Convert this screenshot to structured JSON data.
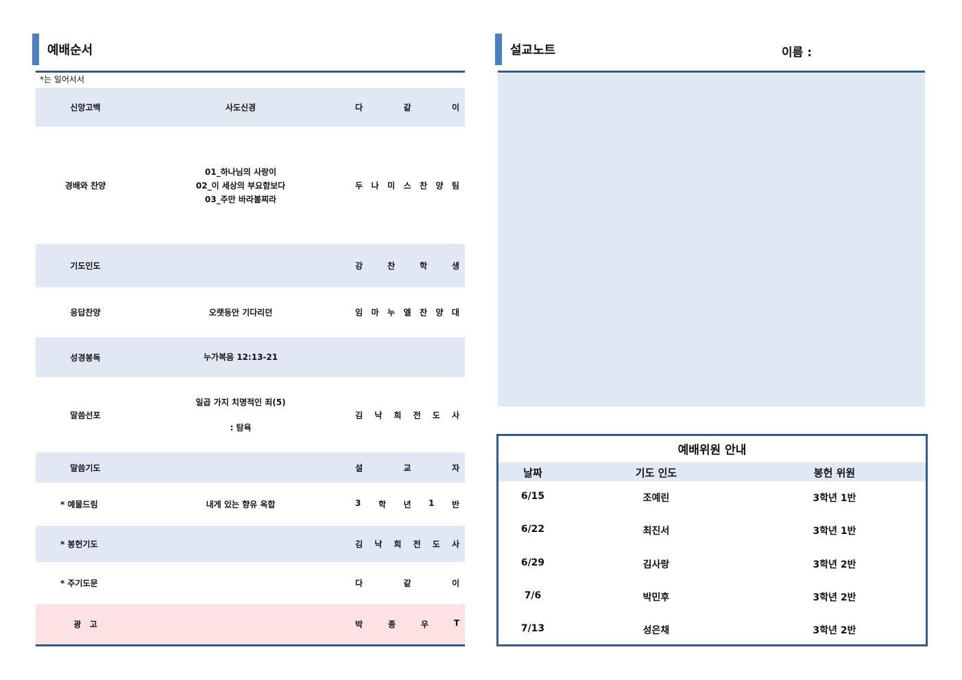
{
  "left": {
    "title": "예배순서",
    "note": "*는 일어서서",
    "rows": [
      {
        "name": "신앙고백",
        "content": [
          "사도신경"
        ],
        "person": [
          "다",
          "같",
          "이"
        ],
        "style": "blue"
      },
      {
        "name": "경배와 찬양",
        "content": [
          "01_하나님의 사랑이",
          "02_이 세상의 부요함보다",
          "03_주만 바라볼찌라"
        ],
        "person": [
          "두",
          "나",
          "미",
          "스",
          "찬",
          "양",
          "팀"
        ],
        "style": "white"
      },
      {
        "name": "기도인도",
        "content": [],
        "person": [
          "강",
          "찬",
          "학",
          "생"
        ],
        "style": "blue"
      },
      {
        "name": "응답찬양",
        "content": [
          "오랫동안 기다리던"
        ],
        "person": [
          "임",
          "마",
          "누",
          "엘",
          "찬",
          "양",
          "대"
        ],
        "style": "white"
      },
      {
        "name": "성경봉독",
        "content": [
          "누가복음 12:13-21"
        ],
        "person": [],
        "style": "blue"
      },
      {
        "name": "말씀선포",
        "content": [
          "일곱 가지 치명적인 죄(5)",
          "",
          ": 탐욕"
        ],
        "person": [
          "김",
          "낙",
          "희",
          "전",
          "도",
          "사"
        ],
        "style": "white"
      },
      {
        "name": "말씀기도",
        "content": [],
        "person": [
          "설",
          "교",
          "자"
        ],
        "style": "blue"
      },
      {
        "name": "* 예물드림",
        "content": [
          "내게 있는 향유 옥합"
        ],
        "person": [
          "3",
          "학",
          "년",
          "1",
          "반"
        ],
        "style": "white"
      },
      {
        "name": "* 봉헌기도",
        "content": [],
        "person": [
          "김",
          "낙",
          "희",
          "전",
          "도",
          "사"
        ],
        "style": "blue"
      },
      {
        "name": "* 주기도문",
        "content": [],
        "person": [
          "다",
          "같",
          "이"
        ],
        "style": "white"
      },
      {
        "name": "광   고",
        "content": [],
        "person": [
          "박",
          "종",
          "우",
          "T"
        ],
        "style": "pink"
      }
    ]
  },
  "right": {
    "title": "설교노트",
    "name_label": "이름 :"
  },
  "committee": {
    "title": "예배위원 안내",
    "headers": [
      "날짜",
      "기도 인도",
      "봉헌 위원"
    ],
    "rows": [
      [
        "6/15",
        "조예린",
        "3학년 1반"
      ],
      [
        "6/22",
        "최진서",
        "3학년 1반"
      ],
      [
        "6/29",
        "김사랑",
        "3학년 2반"
      ],
      [
        "7/6",
        "박민후",
        "3학년 2반"
      ],
      [
        "7/13",
        "성은채",
        "3학년 2반"
      ]
    ]
  },
  "colors": {
    "accent": "#4a7fc1",
    "rule": "#2e5a8f",
    "row_blue": "#dfe8f3",
    "row_pink": "#fde2e4"
  }
}
